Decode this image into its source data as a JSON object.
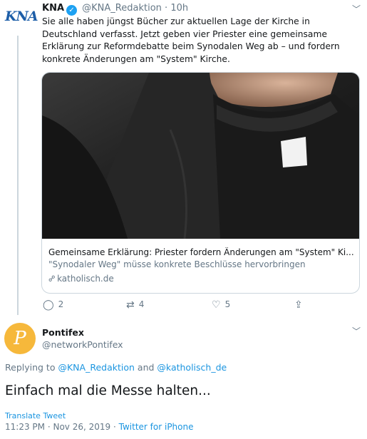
{
  "tweet1": {
    "author_logo_text": "KNA",
    "author_name": "KNA",
    "verified_icon": "check",
    "handle": "@KNA_Redaktion",
    "separator": "·",
    "time": "10h",
    "text": "Sie alle haben jüngst Bücher zur aktuellen Lage der Kirche in Deutschland verfasst. Jetzt geben vier Priester eine gemeinsame Erklärung zur Reformdebatte beim Synodalen Weg ab – und fordern konkrete Änderungen am \"System\" Kirche.",
    "card": {
      "title": "Gemeinsame Erklärung: Priester fordern Änderungen am \"System\" Ki...",
      "description": "\"Synodaler Weg\" müsse konkrete Beschlüsse hervorbringen",
      "domain": "katholisch.de"
    },
    "actions": {
      "reply_count": "2",
      "retweet_count": "4",
      "like_count": "5"
    }
  },
  "tweet2": {
    "avatar_letter": "P",
    "author_name": "Pontifex",
    "handle": "@networkPontifex",
    "replying_prefix": "Replying to",
    "mention1": "@KNA_Redaktion",
    "and_word": "and",
    "mention2": "@katholisch_de",
    "text": "Einfach mal die Messe halten...",
    "translate_label": "Translate Tweet",
    "time": "11:23 PM",
    "date": "Nov 26, 2019",
    "source": "Twitter for iPhone",
    "separator": "·"
  },
  "colors": {
    "link_blue": "#1b95e0",
    "secondary_text": "#657786",
    "verified_blue": "#1da1f2",
    "avatar_orange": "#f6b83b"
  }
}
